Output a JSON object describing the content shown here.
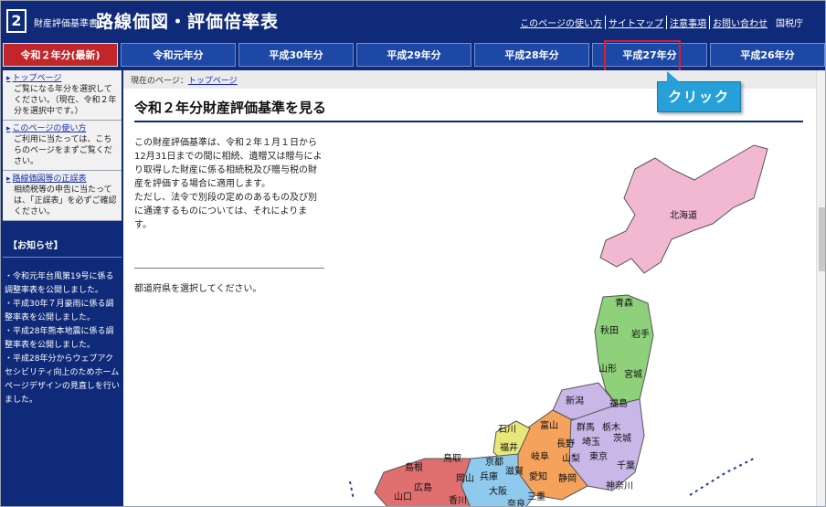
{
  "header": {
    "logo_number": "2",
    "site_sub": "財産評価基準書",
    "site_title": "路線価図・評価倍率表",
    "util_links": [
      "このページの使い方",
      "サイトマップ",
      "注意事項",
      "お問い合わせ"
    ],
    "agency": "国税庁"
  },
  "tabs": [
    "令和２年分(最新)",
    "令和元年分",
    "平成30年分",
    "平成29年分",
    "平成28年分",
    "平成27年分",
    "平成26年分"
  ],
  "callout": "クリック",
  "sidebar": {
    "blocks": [
      {
        "link": "トップページ",
        "desc": "ご覧になる年分を選択してください。（現在、令和２年分を選択中です。）"
      },
      {
        "link": "このページの使い方",
        "desc": "ご利用に当たっては、こちらのページをまずご覧ください。"
      },
      {
        "link": "路線価図等の正誤表",
        "desc": "相続税等の申告に当たっては、「正誤表」を必ずご確認ください。"
      }
    ],
    "notice_title": "【お知らせ】",
    "notices": [
      "・令和元年台風第19号に係る調整率表を公開しました。",
      "・平成30年７月豪雨に係る調整率表を公開しました。",
      "・平成28年熊本地震に係る調整率表を公開しました。",
      "・平成28年分からウェブアクセシビリティ向上のためホームページデザインの見直しを行いました。"
    ]
  },
  "main": {
    "breadcrumb_prefix": "現在のページ：",
    "breadcrumb_link": "トップページ",
    "title": "令和２年分財産評価基準を見る",
    "intro_1": "この財産評価基準は、令和２年１月１日から12月31日までの間に相続、遺贈又は贈与により取得した財産に係る相続税及び贈与税の財産を評価する場合に適用します。",
    "intro_2": "ただし、法令で別段の定めのあるもの及び別に通達するものについては、それによります。",
    "select_text": "都道府県を選択してください。"
  },
  "map": {
    "prefectures": [
      "北海道",
      "青森",
      "秋田",
      "岩手",
      "山形",
      "宮城",
      "新潟",
      "福島",
      "富山",
      "群馬",
      "栃木",
      "石川",
      "長野",
      "埼玉",
      "茨城",
      "福井",
      "岐阜",
      "山梨",
      "東京",
      "千葉",
      "島根",
      "鳥取",
      "京都",
      "兵庫",
      "滋賀",
      "愛知",
      "静岡",
      "神奈川",
      "岡山",
      "広島",
      "大阪",
      "三重",
      "山口",
      "香川",
      "奈良"
    ],
    "colors": {
      "hokkaido": "#f2b8d2",
      "tohoku": "#8fd07a",
      "kanto": "#c9b7e8",
      "chubu": "#f5a25c",
      "hokuriku": "#e8e87a",
      "kinki": "#8fc9ec",
      "chugoku": "#e06f6f"
    }
  }
}
